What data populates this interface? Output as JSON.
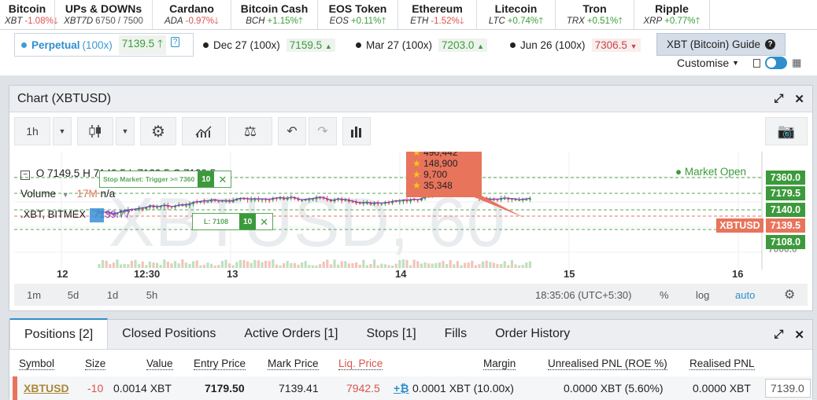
{
  "tickers": [
    {
      "name": "Bitcoin",
      "sym": "XBT",
      "change": "-1.08%",
      "dir": "down"
    },
    {
      "name": "UPs & DOWNs",
      "sym": "XBT7D",
      "change": "6750 / 7500",
      "dir": "none"
    },
    {
      "name": "Cardano",
      "sym": "ADA",
      "change": "-0.97%",
      "dir": "down"
    },
    {
      "name": "Bitcoin Cash",
      "sym": "BCH",
      "change": "+1.15%",
      "dir": "up"
    },
    {
      "name": "EOS Token",
      "sym": "EOS",
      "change": "+0.11%",
      "dir": "up"
    },
    {
      "name": "Ethereum",
      "sym": "ETH",
      "change": "-1.52%",
      "dir": "down"
    },
    {
      "name": "Litecoin",
      "sym": "LTC",
      "change": "+0.74%",
      "dir": "up"
    },
    {
      "name": "Tron",
      "sym": "TRX",
      "change": "+0.51%",
      "dir": "up"
    },
    {
      "name": "Ripple",
      "sym": "XRP",
      "change": "+0.77%",
      "dir": "up"
    }
  ],
  "contracts": {
    "perpetual": {
      "label": "Perpetual",
      "lev": "(100x)",
      "price": "7139.5"
    },
    "dec": {
      "label": "Dec 27 (100x)",
      "price": "7159.5"
    },
    "mar": {
      "label": "Mar 27 (100x)",
      "price": "7203.0"
    },
    "jun": {
      "label": "Jun 26 (100x)",
      "price": "7306.5"
    },
    "guide": "XBT (Bitcoin) Guide",
    "customise": "Customise"
  },
  "chart": {
    "title": "Chart (XBTUSD)",
    "interval": "1h",
    "watermark": "XBTUSD, 60",
    "ohlc": {
      "o": "7149.5",
      "h": "7149.5",
      "l": "7129.5",
      "c": "7139.5"
    },
    "market_status": "Market Open",
    "volume_label": "Volume",
    "volume_value": "17M",
    "volume_na": "n/a",
    "symbol_line": ".XBT, BITMEX",
    "symbol_value": "7139.77",
    "stop_label": "Stop Market: Trigger >= 7360",
    "stop_qty": "10",
    "limit_label": "L: 7108",
    "limit_qty": "10",
    "tooltip": [
      "490,442",
      "148,900",
      "9,700",
      "35,348"
    ],
    "price_tags": [
      {
        "value": "7360.0",
        "color": "#3c9a3c"
      },
      {
        "value": "7179.5",
        "color": "#3c9a3c"
      },
      {
        "value": "7140.0",
        "color": "#3c9a3c"
      },
      {
        "value": "7139.5",
        "color": "#e8745c"
      },
      {
        "value": "7108.0",
        "color": "#3c9a3c"
      }
    ],
    "xbtusd_tag": "XBTUSD",
    "y_axis_label": "7000.0",
    "x_ticks": [
      "12",
      "12:30",
      "13",
      "14",
      "15",
      "16"
    ],
    "ranges": [
      "1m",
      "5d",
      "1d",
      "5h"
    ],
    "time": "18:35:06 (UTC+5:30)",
    "scale_opts": [
      "%",
      "log",
      "auto"
    ],
    "colors": {
      "up": "#3b9c3b",
      "down": "#d9534f",
      "accent": "#2f8ecb",
      "tooltip": "#e8745c"
    }
  },
  "positions": {
    "tabs": [
      "Positions [2]",
      "Closed Positions",
      "Active Orders [1]",
      "Stops [1]",
      "Fills",
      "Order History"
    ],
    "columns": [
      "Symbol",
      "Size",
      "Value",
      "Entry Price",
      "Mark Price",
      "Liq. Price",
      "Margin",
      "Unrealised PNL (ROE %)",
      "Realised PNL"
    ],
    "row": {
      "symbol": "XBTUSD",
      "size": "-10",
      "value": "0.0014 XBT",
      "entry": "7179.50",
      "mark": "7139.41",
      "liq": "7942.5",
      "margin": "0.0001 XBT (10.00x)",
      "unrealised": "0.0000 XBT (5.60%)",
      "realised": "0.0000 XBT",
      "close_price": "7139.0"
    }
  }
}
